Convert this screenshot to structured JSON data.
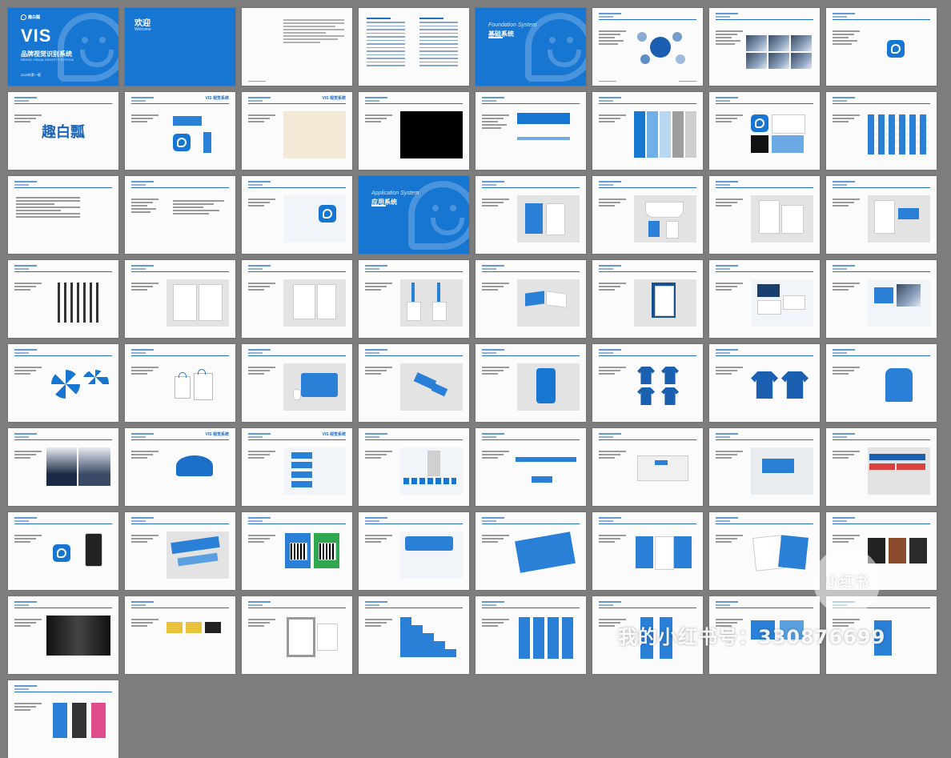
{
  "cover": {
    "logo_text": "趣白瓢",
    "title": "VIS",
    "subtitle": "品牌视觉识别系统",
    "subtitle_en": "BRAND VISUAL IDENTITY SYSTEM",
    "date": "2020年第一版"
  },
  "welcome": {
    "title": "欢迎",
    "subtitle": "Welcome"
  },
  "foundation_section": {
    "en": "Foundation System",
    "cn": "基础系统"
  },
  "application_section": {
    "en": "Application System",
    "cn": "应用系统"
  },
  "brand_wordmark": "趣白瓢",
  "header_tag": "VIS 视觉系统",
  "watermark": {
    "badge": "小红书",
    "text": "我的小红书号：330876699"
  },
  "colors": {
    "primary": "#1676d2",
    "dark_blue": "#1a5fb0",
    "background": "#7d7d7d"
  }
}
